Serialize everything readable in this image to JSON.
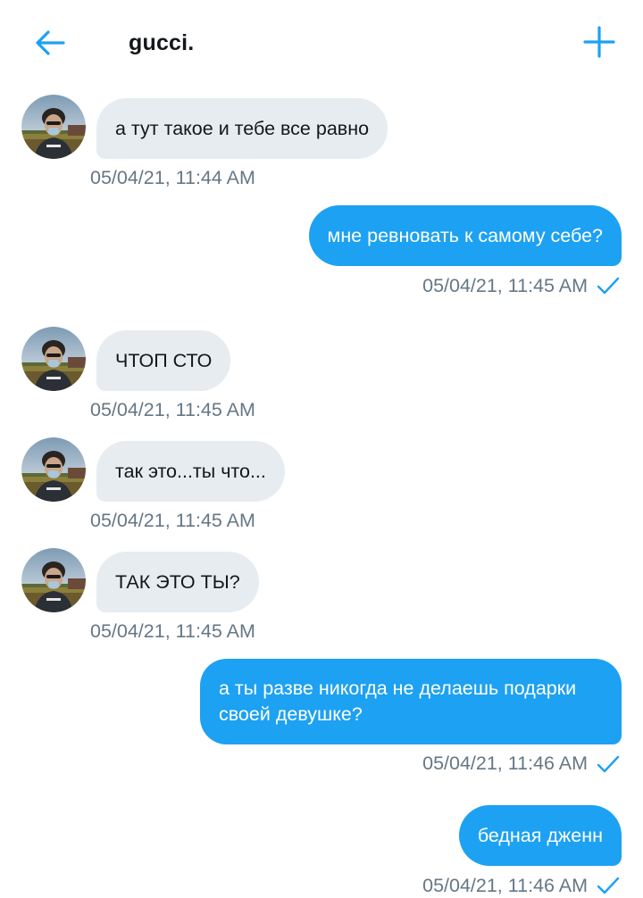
{
  "header": {
    "title": "gucci.",
    "back_icon": "back-arrow-icon",
    "add_icon": "plus-icon",
    "accent_color": "#1da1f2"
  },
  "messages": [
    {
      "direction": "incoming",
      "text": "а тут такое и тебе все равно",
      "time": "05/04/21, 11:44 AM"
    },
    {
      "direction": "outgoing",
      "text": "мне ревновать к самому себе?",
      "time": "05/04/21, 11:45 AM",
      "status_icon": "read-check-icon"
    },
    {
      "direction": "incoming",
      "text": "ЧТОП СТО",
      "time": "05/04/21, 11:45 AM"
    },
    {
      "direction": "incoming",
      "text": "так это...ты что...",
      "time": "05/04/21, 11:45 AM"
    },
    {
      "direction": "incoming",
      "text": "ТАК ЭТО ТЫ?",
      "time": "05/04/21, 11:45 AM"
    },
    {
      "direction": "outgoing",
      "text": "а ты разве никогда не делаешь подарки своей девушке?",
      "time": "05/04/21, 11:46 AM",
      "status_icon": "read-check-icon"
    },
    {
      "direction": "outgoing",
      "text": "бедная дженн",
      "time": "05/04/21, 11:46 AM",
      "status_icon": "read-check-icon"
    }
  ],
  "colors": {
    "incoming_bubble": "#e6ecf0",
    "outgoing_bubble": "#1da1f2",
    "timestamp": "#657786"
  }
}
